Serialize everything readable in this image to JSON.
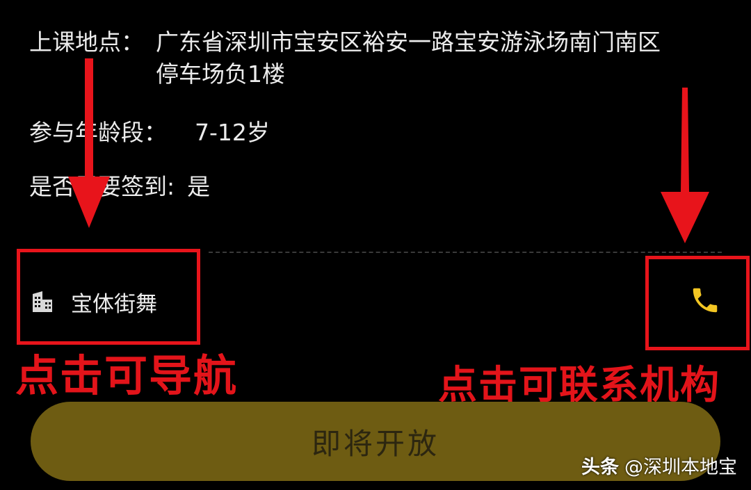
{
  "details": {
    "location_label": "上课地点：",
    "location_value_line1": "广东省深圳市宝安区裕安一路宝安游泳场南门南区",
    "location_value_line2": "停车场负1楼",
    "age_label": "参与年龄段：",
    "age_value": "7-12岁",
    "signin_label": "是否需要签到:",
    "signin_value": "是"
  },
  "organization": {
    "name": "宝体街舞",
    "icon": "building-icon"
  },
  "phone": {
    "icon": "phone-icon",
    "color": "#f3c623"
  },
  "annotations": {
    "nav_hint": "点击可导航",
    "contact_hint": "点击可联系机构",
    "color": "#e3141a"
  },
  "cta": {
    "label": "即将开放",
    "background": "#6e5c12"
  },
  "watermark": {
    "brand": "头条",
    "handle": "@深圳本地宝"
  }
}
